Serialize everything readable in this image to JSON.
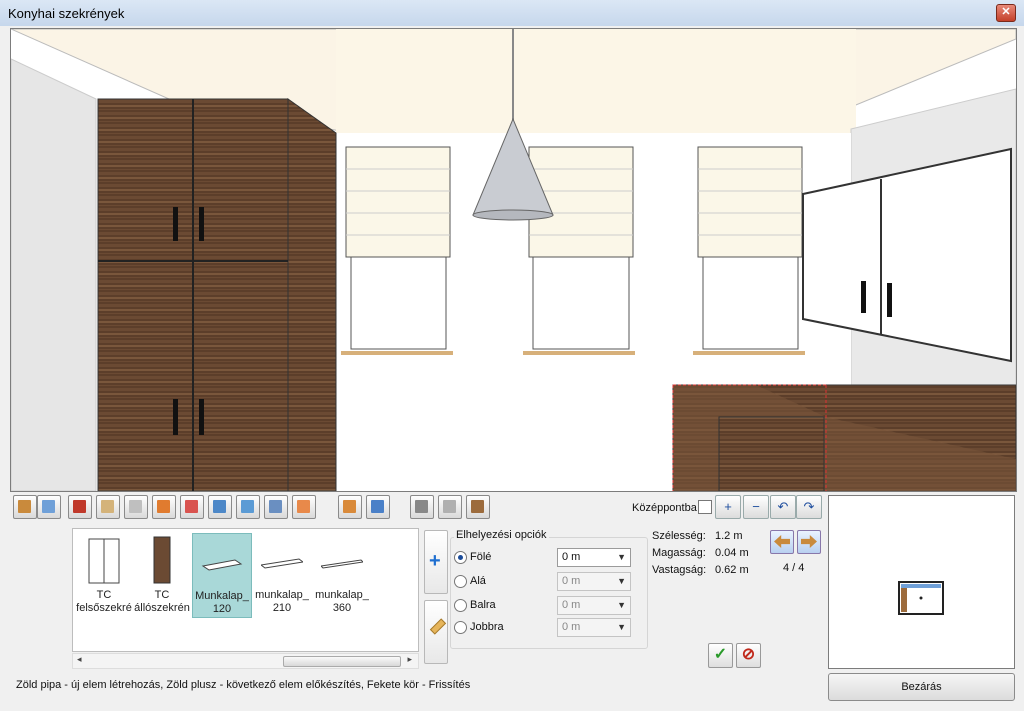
{
  "window": {
    "title": "Konyhai szekrények",
    "close_glyph": "✕"
  },
  "toolbar": {
    "buttons": [
      {
        "icon": "door-icon",
        "color": "#c98a3c"
      },
      {
        "icon": "window-icon",
        "color": "#6fa0d8"
      },
      {
        "icon": "frame-icon",
        "color": "#c0392b"
      },
      {
        "icon": "cabinet-icon",
        "color": "#d4b37a"
      },
      {
        "icon": "bathtub-icon",
        "color": "#bfbfbf"
      },
      {
        "icon": "lamp-icon",
        "color": "#e07b2f"
      },
      {
        "icon": "floor-lamp-icon",
        "color": "#d9534f"
      },
      {
        "icon": "picture-icon",
        "color": "#4d88c8"
      },
      {
        "icon": "floor-tile-icon",
        "color": "#5b9bd5"
      },
      {
        "icon": "wall-tile-icon",
        "color": "#6a8fc1"
      },
      {
        "icon": "paint-icon",
        "color": "#e8894a"
      },
      {
        "icon": "texture-icon",
        "color": "#d98a3a"
      },
      {
        "icon": "texture-blue-icon",
        "color": "#4a80c8"
      },
      {
        "icon": "sink-icon",
        "color": "#888888"
      },
      {
        "icon": "faucet-icon",
        "color": "#b0b0b0"
      },
      {
        "icon": "wardrobe-icon",
        "color": "#9c6b3c"
      }
    ],
    "center_label": "Középpontba",
    "zoom_in": "+",
    "zoom_out": "−",
    "undo": "↶",
    "redo": "↷"
  },
  "gallery": {
    "items": [
      {
        "label": "TC felsőszekré"
      },
      {
        "label": "TC állószekrén"
      },
      {
        "label": "Munkalap_ 120",
        "selected": true
      },
      {
        "label": "munkalap_ 210"
      },
      {
        "label": "munkalap_ 360"
      }
    ],
    "scroll_left": "◂",
    "scroll_right": "▸",
    "scroll_grip": "|||"
  },
  "side": {
    "add": "+",
    "edit_icon": "pencil-icon"
  },
  "placement": {
    "legend": "Elhelyezési opciók",
    "options": [
      {
        "label": "Fölé",
        "value": "0 m",
        "selected": true,
        "enabled": true
      },
      {
        "label": "Alá",
        "value": "0 m",
        "selected": false,
        "enabled": false
      },
      {
        "label": "Balra",
        "value": "0 m",
        "selected": false,
        "enabled": false
      },
      {
        "label": "Jobbra",
        "value": "0 m",
        "selected": false,
        "enabled": false
      }
    ],
    "arrow": "▼"
  },
  "dims": [
    {
      "label": "Szélesség:",
      "value": "1.2 m"
    },
    {
      "label": "Magasság:",
      "value": "0.04 m"
    },
    {
      "label": "Vastagság:",
      "value": "0.62 m"
    }
  ],
  "pager": {
    "text": "4 / 4"
  },
  "actions": {
    "ok": "✓",
    "cancel": "⊘"
  },
  "status": "Zöld pipa - új elem létrehozás, Zöld plusz - következő elem előkészítés, Fekete kör - Frissítés",
  "close_button": "Bezárás"
}
